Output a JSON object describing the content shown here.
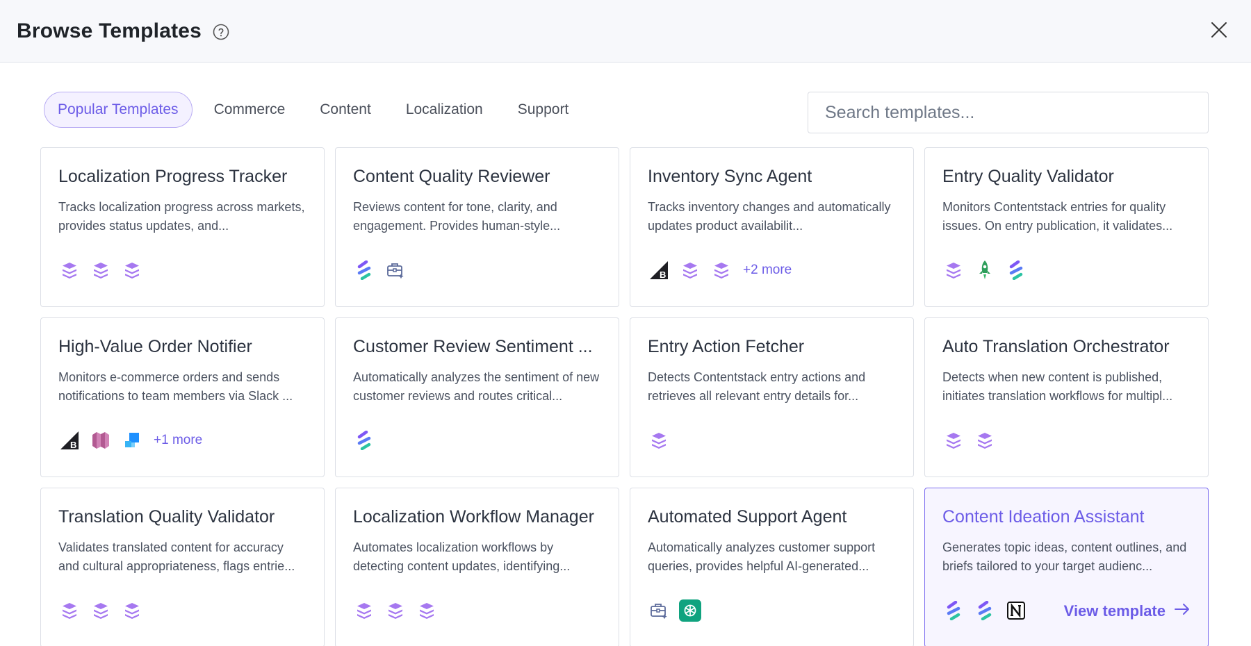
{
  "header": {
    "title": "Browse Templates"
  },
  "tabs": [
    {
      "label": "Popular Templates",
      "active": true
    },
    {
      "label": "Commerce",
      "active": false
    },
    {
      "label": "Content",
      "active": false
    },
    {
      "label": "Localization",
      "active": false
    },
    {
      "label": "Support",
      "active": false
    }
  ],
  "search": {
    "placeholder": "Search templates...",
    "value": ""
  },
  "accent_color": "#6c5ce7",
  "cards": [
    {
      "title": "Localization Progress Tracker",
      "description": "Tracks localization progress across markets, provides status updates, and...",
      "icons": [
        "contentstack-icon",
        "contentstack-icon",
        "contentstack-icon"
      ],
      "more": ""
    },
    {
      "title": "Content Quality Reviewer",
      "description": "Reviews content for tone, clarity, and engagement. Provides human-style...",
      "icons": [
        "stack-s-icon",
        "toolbox-icon"
      ],
      "more": ""
    },
    {
      "title": "Inventory Sync Agent",
      "description": "Tracks inventory changes and automatically updates product availabilit...",
      "icons": [
        "bigcommerce-icon",
        "contentstack-icon",
        "contentstack-icon"
      ],
      "more": "+2 more"
    },
    {
      "title": "Entry Quality Validator",
      "description": "Monitors Contentstack entries for quality issues. On entry publication, it validates...",
      "icons": [
        "contentstack-icon",
        "rocket-icon",
        "stack-s-icon"
      ],
      "more": ""
    },
    {
      "title": "High-Value Order Notifier",
      "description": "Monitors e-commerce orders and sends notifications to team members via Slack ...",
      "icons": [
        "bigcommerce-icon",
        "aws-icon",
        "blocks-icon"
      ],
      "more": "+1 more"
    },
    {
      "title": "Customer Review Sentiment ...",
      "description": "Automatically analyzes the sentiment of new customer reviews and routes critical...",
      "icons": [
        "stack-s-icon"
      ],
      "more": ""
    },
    {
      "title": "Entry Action Fetcher",
      "description": "Detects Contentstack entry actions and retrieves all relevant entry details for...",
      "icons": [
        "contentstack-icon"
      ],
      "more": ""
    },
    {
      "title": "Auto Translation Orchestrator",
      "description": "Detects when new content is published, initiates translation workflows for multipl...",
      "icons": [
        "contentstack-icon",
        "contentstack-icon"
      ],
      "more": ""
    },
    {
      "title": "Translation Quality Validator",
      "description": "Validates translated content for accuracy and cultural appropriateness, flags entrie...",
      "icons": [
        "contentstack-icon",
        "contentstack-icon",
        "contentstack-icon"
      ],
      "more": ""
    },
    {
      "title": "Localization Workflow Manager",
      "description": "Automates localization workflows by detecting content updates, identifying...",
      "icons": [
        "contentstack-icon",
        "contentstack-icon",
        "contentstack-icon"
      ],
      "more": ""
    },
    {
      "title": "Automated Support Agent",
      "description": "Automatically analyzes customer support queries, provides helpful AI-generated...",
      "icons": [
        "toolbox-icon",
        "openai-icon"
      ],
      "more": ""
    },
    {
      "title": "Content Ideation Assistant",
      "description": "Generates topic ideas, content outlines, and briefs tailored to your target audienc...",
      "icons": [
        "stack-s-icon",
        "stack-s-icon",
        "notion-icon"
      ],
      "more": "",
      "hovered": true,
      "cta": "View template"
    }
  ]
}
